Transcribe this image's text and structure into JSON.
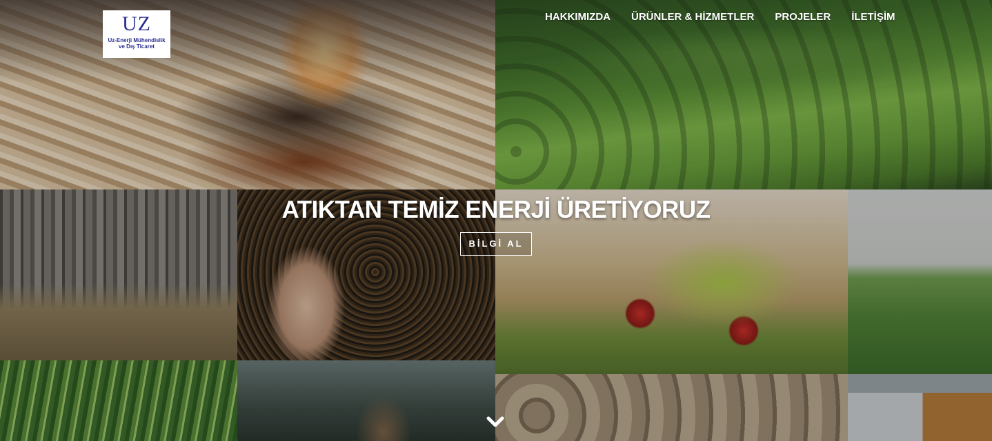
{
  "logo": {
    "mark": "UZ",
    "company_line1": "Uz-Enerji Mühendislik",
    "company_line2": "ve Dış Ticaret"
  },
  "nav": {
    "items": [
      {
        "label": "HAKKIMIZDA"
      },
      {
        "label": "ÜRÜNLER & HİZMETLER"
      },
      {
        "label": "PROJELER"
      },
      {
        "label": "İLETİŞİM"
      }
    ]
  },
  "hero": {
    "title": "ATIKTAN TEMİZ ENERJİ ÜRETİYORUZ",
    "button_label": "BİLGİ AL"
  },
  "icons": {
    "scroll": "chevron-down-icon"
  }
}
